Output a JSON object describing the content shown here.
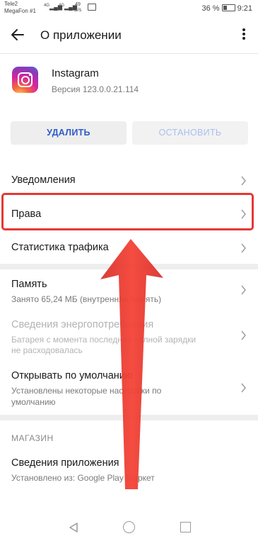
{
  "status_bar": {
    "carrier1": "Tele2",
    "carrier2": "MegaFon #1",
    "signal1": "4G",
    "signal2": "4G",
    "speed_value": "49",
    "speed_unit": "B/s",
    "battery": "36 %",
    "time": "9:21"
  },
  "header": {
    "title": "О приложении"
  },
  "app": {
    "name": "Instagram",
    "version": "Версия 123.0.0.21.114"
  },
  "buttons": {
    "delete": "УДАЛИТЬ",
    "stop": "ОСТАНОВИТЬ"
  },
  "rows": {
    "notifications": {
      "title": "Уведомления"
    },
    "permissions": {
      "title": "Права"
    },
    "traffic": {
      "title": "Статистика трафика"
    },
    "memory": {
      "title": "Память",
      "sub": "Занято 65,24 МБ (внутренняя память)"
    },
    "energy": {
      "title": "Сведения энергопотребления",
      "sub1": "Батарея с момента последней полной зарядки",
      "sub2": "не расходовалась"
    },
    "defaults": {
      "title": "Открывать по умолчанию",
      "sub1": "Установлены некоторые настройки по",
      "sub2": "умолчанию"
    }
  },
  "store": {
    "section_label": "МАГАЗИН",
    "title": "Сведения приложения",
    "sub": "Установлено из: Google Play Маркет"
  },
  "icons": {
    "back": "arrow-left-icon",
    "menu": "more-vert-icon",
    "chevron": "chevron-right-icon",
    "nav_back": "triangle-back-icon",
    "nav_home": "circle-home-icon",
    "nav_recent": "square-recent-icon"
  },
  "colors": {
    "accent": "#2d5cc9",
    "annotation_red": "#e53935"
  }
}
